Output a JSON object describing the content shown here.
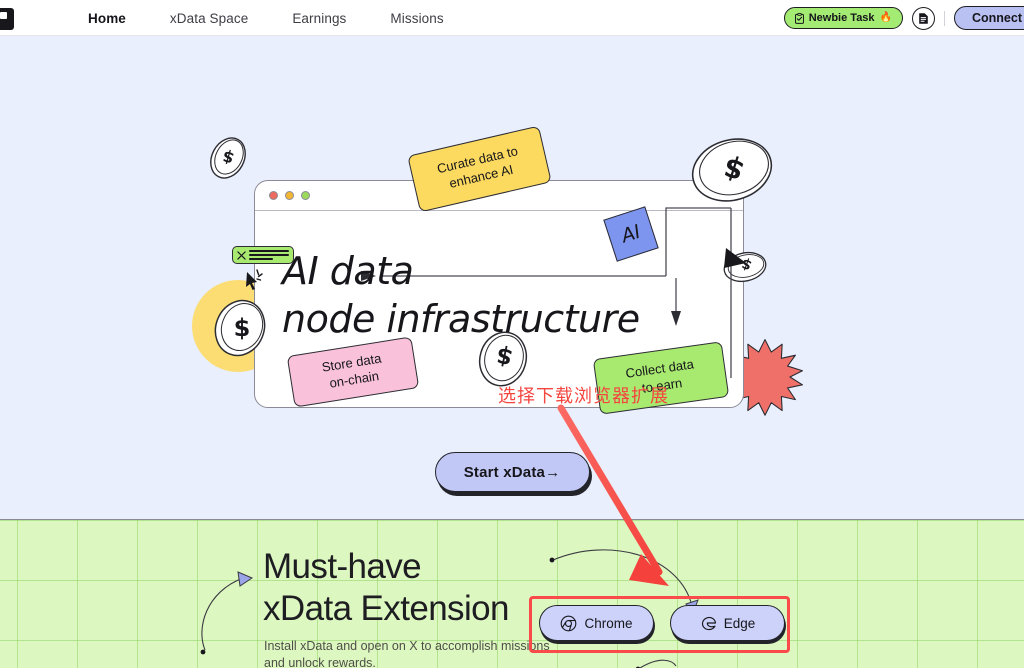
{
  "navbar": {
    "logo_name": "xdata-logo",
    "links": [
      {
        "label": "Home",
        "active": true
      },
      {
        "label": "xData Space",
        "active": false
      },
      {
        "label": "Earnings",
        "active": false
      },
      {
        "label": "Missions",
        "active": false
      }
    ],
    "newbie_task": {
      "label": "Newbie Task",
      "fire": "🔥"
    },
    "docs_icon": "document-icon",
    "connect_label": "Connect"
  },
  "hero": {
    "heading": "AI data\nnode infrastructure",
    "notes": {
      "curate": "Curate data to\nenhance AI",
      "store": "Store data\non-chain",
      "collect": "Collect data\nto earn"
    },
    "ai_chip_label": "AI",
    "cta_label": "Start xData→"
  },
  "annotation": {
    "text": "选择下载浏览器扩展",
    "color": "#f4453f"
  },
  "extension": {
    "title": "Must-have\nxData Extension",
    "subtitle": "Install xData and open on X to accomplish missions\nand unlock rewards.",
    "buttons": [
      {
        "label": "Chrome",
        "icon": "chrome-icon"
      },
      {
        "label": "Edge",
        "icon": "edge-icon"
      }
    ]
  },
  "colors": {
    "hero_bg": "#e9effc",
    "green_bg": "#ddf7c0",
    "accent_periwinkle": "#c2c8f5",
    "accent_green": "#a8ea6f",
    "note_yellow": "#fcd95f",
    "note_pink": "#f9c2da",
    "annotation_red": "#f4453f"
  }
}
